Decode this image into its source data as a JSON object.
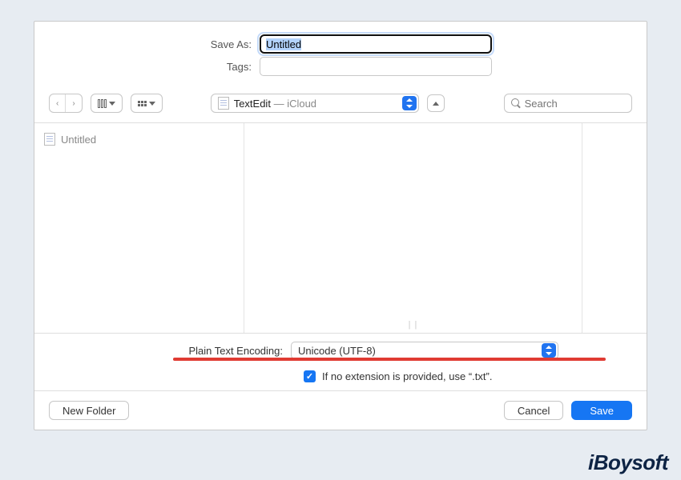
{
  "labels": {
    "save_as": "Save As:",
    "tags": "Tags:",
    "encoding": "Plain Text Encoding:",
    "extension_hint": "If no extension is provided, use “.txt”."
  },
  "fields": {
    "filename": "Untitled",
    "tags": "",
    "search_placeholder": "Search"
  },
  "location": {
    "app": "TextEdit",
    "place": "iCloud"
  },
  "sidebar": {
    "items": [
      {
        "name": "Untitled"
      }
    ]
  },
  "encoding": {
    "value": "Unicode (UTF-8)"
  },
  "buttons": {
    "new_folder": "New Folder",
    "cancel": "Cancel",
    "save": "Save"
  },
  "watermark": "iBoysoft"
}
